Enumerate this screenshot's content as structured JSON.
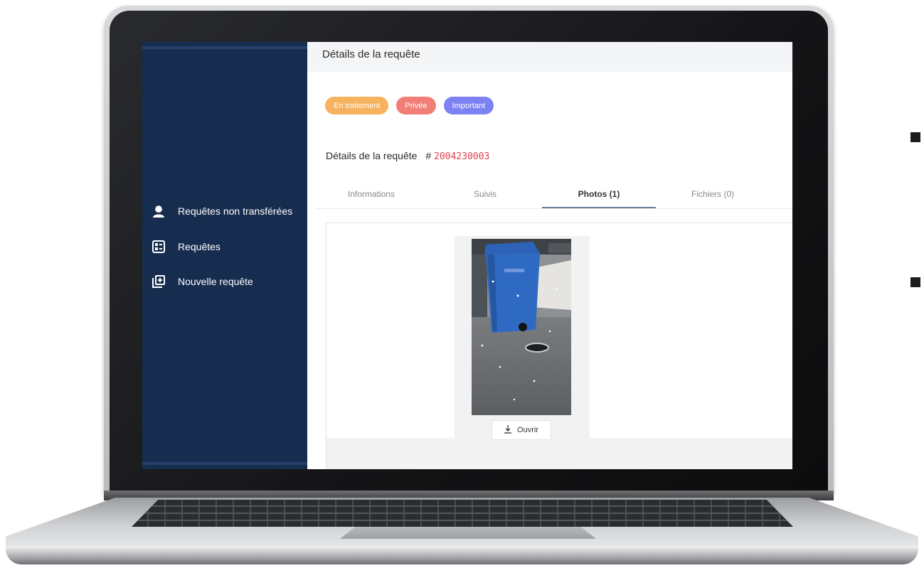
{
  "header": {
    "title": "Détails de la requête"
  },
  "badges": [
    {
      "label": "En traitement",
      "color": "#f6b25e"
    },
    {
      "label": "Privée",
      "color": "#f17e77"
    },
    {
      "label": "Important",
      "color": "#7c81f4"
    }
  ],
  "request": {
    "title": "Détails de la requête",
    "hash": "#",
    "number": "2004230003"
  },
  "sidebar": {
    "items": [
      {
        "label": "Requêtes non transférées",
        "icon": "user-headset-icon"
      },
      {
        "label": "Requêtes",
        "icon": "list-icon"
      },
      {
        "label": "Nouvelle requête",
        "icon": "add-request-icon"
      }
    ]
  },
  "tabs": [
    {
      "label": "Informations",
      "active": false
    },
    {
      "label": "Suivis",
      "active": false
    },
    {
      "label": "Photos (1)",
      "active": true
    },
    {
      "label": "Fichiers (0)",
      "active": false
    }
  ],
  "photos": [
    {
      "open_label": "Ouvrir",
      "icon": "download-icon"
    }
  ],
  "colors": {
    "sidebar": "#172d4f",
    "request_number": "#e0404e",
    "tab_underline": "#6b7f98"
  }
}
